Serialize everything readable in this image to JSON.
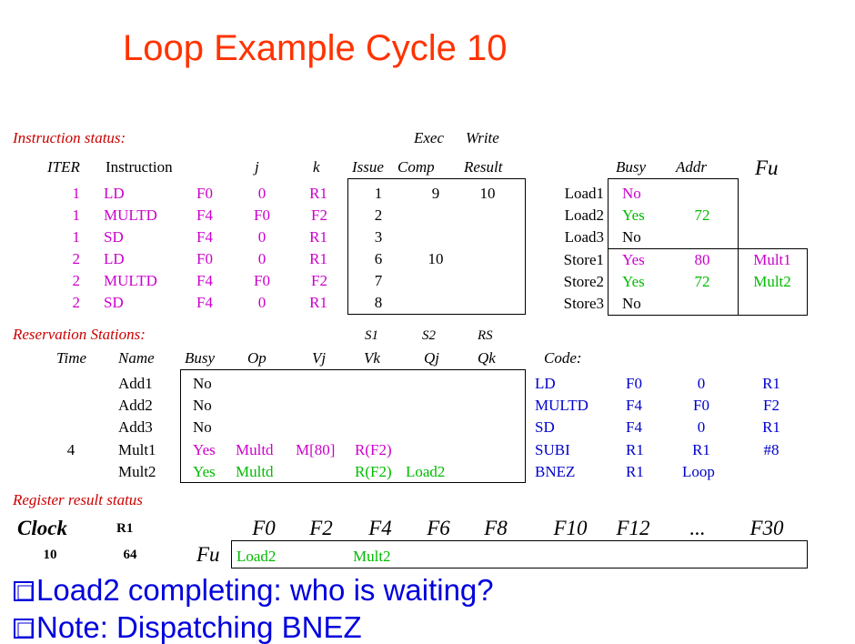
{
  "title": "Loop Example Cycle 10",
  "instr": {
    "section": "Instruction status:",
    "headers": {
      "exec": "Exec",
      "write": "Write",
      "iter": "ITER",
      "instruction": "Instruction",
      "j": "j",
      "k": "k",
      "issue": "Issue",
      "comp": "Comp",
      "result": "Result"
    },
    "rows": [
      {
        "iter": "1",
        "op": "LD",
        "dst": "F0",
        "j": "0",
        "k": "R1",
        "issue": "1",
        "comp": "9",
        "result": "10"
      },
      {
        "iter": "1",
        "op": "MULTD",
        "dst": "F4",
        "j": "F0",
        "k": "F2",
        "issue": "2",
        "comp": "",
        "result": ""
      },
      {
        "iter": "1",
        "op": "SD",
        "dst": "F4",
        "j": "0",
        "k": "R1",
        "issue": "3",
        "comp": "",
        "result": ""
      },
      {
        "iter": "2",
        "op": "LD",
        "dst": "F0",
        "j": "0",
        "k": "R1",
        "issue": "6",
        "comp": "10",
        "result": ""
      },
      {
        "iter": "2",
        "op": "MULTD",
        "dst": "F4",
        "j": "F0",
        "k": "F2",
        "issue": "7",
        "comp": "",
        "result": ""
      },
      {
        "iter": "2",
        "op": "SD",
        "dst": "F4",
        "j": "0",
        "k": "R1",
        "issue": "8",
        "comp": "",
        "result": ""
      }
    ]
  },
  "buffers": {
    "headers": {
      "busy": "Busy",
      "addr": "Addr",
      "fu": "Fu"
    },
    "rows": [
      {
        "name": "Load1",
        "busy": "No",
        "addr": "",
        "fu": ""
      },
      {
        "name": "Load2",
        "busy": "Yes",
        "addr": "72",
        "fu": ""
      },
      {
        "name": "Load3",
        "busy": "No",
        "addr": "",
        "fu": ""
      },
      {
        "name": "Store1",
        "busy": "Yes",
        "addr": "80",
        "fu": "Mult1"
      },
      {
        "name": "Store2",
        "busy": "Yes",
        "addr": "72",
        "fu": "Mult2"
      },
      {
        "name": "Store3",
        "busy": "No",
        "addr": "",
        "fu": ""
      }
    ]
  },
  "rs": {
    "section": "Reservation Stations:",
    "top_headers": {
      "s1": "S1",
      "s2": "S2",
      "rs": "RS"
    },
    "headers": {
      "time": "Time",
      "name": "Name",
      "busy": "Busy",
      "op": "Op",
      "vj": "Vj",
      "vk": "Vk",
      "qj": "Qj",
      "qk": "Qk"
    },
    "rows": [
      {
        "time": "",
        "name": "Add1",
        "busy": "No",
        "op": "",
        "vj": "",
        "vk": "",
        "qj": "",
        "qk": ""
      },
      {
        "time": "",
        "name": "Add2",
        "busy": "No",
        "op": "",
        "vj": "",
        "vk": "",
        "qj": "",
        "qk": ""
      },
      {
        "time": "",
        "name": "Add3",
        "busy": "No",
        "op": "",
        "vj": "",
        "vk": "",
        "qj": "",
        "qk": ""
      },
      {
        "time": "4",
        "name": "Mult1",
        "busy": "Yes",
        "op": "Multd",
        "vj": "M[80]",
        "vk": "R(F2)",
        "qj": "",
        "qk": ""
      },
      {
        "time": "",
        "name": "Mult2",
        "busy": "Yes",
        "op": "Multd",
        "vj": "",
        "vk": "R(F2)",
        "qj": "Load2",
        "qk": ""
      }
    ]
  },
  "code": {
    "label": "Code:",
    "rows": [
      {
        "op": "LD",
        "a": "F0",
        "b": "0",
        "c": "R1"
      },
      {
        "op": "MULTD",
        "a": "F4",
        "b": "F0",
        "c": "F2"
      },
      {
        "op": "SD",
        "a": "F4",
        "b": "0",
        "c": "R1"
      },
      {
        "op": "SUBI",
        "a": "R1",
        "b": "R1",
        "c": "#8"
      },
      {
        "op": "BNEZ",
        "a": "R1",
        "b": "Loop",
        "c": ""
      }
    ]
  },
  "reg": {
    "section": "Register result status",
    "clock_label": "Clock",
    "r1_label": "R1",
    "clock": "10",
    "r1": "64",
    "fu_label": "Fu",
    "regs": [
      "F0",
      "F2",
      "F4",
      "F6",
      "F8",
      "F10",
      "F12",
      "...",
      "F30"
    ],
    "values": [
      "Load2",
      "",
      "Mult2",
      "",
      "",
      "",
      "",
      "",
      ""
    ]
  },
  "bullets": [
    "Load2 completing: who is waiting?",
    "Note: Dispatching BNEZ"
  ]
}
